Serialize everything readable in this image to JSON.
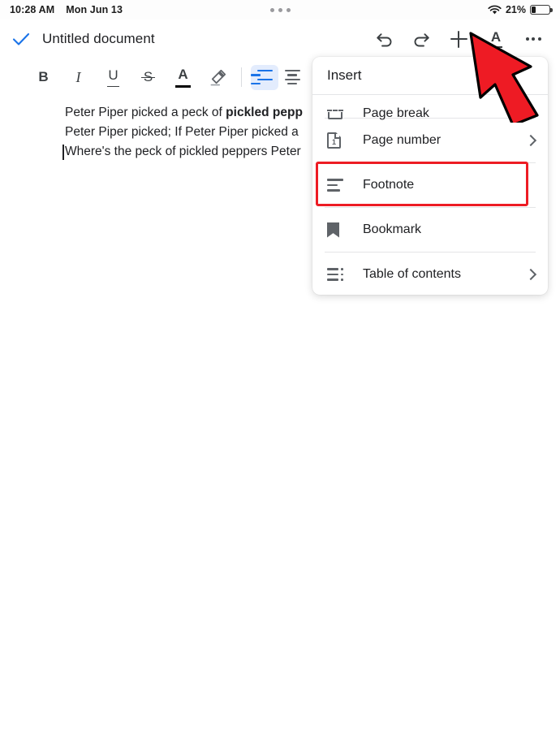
{
  "status_bar": {
    "time": "10:28 AM",
    "date": "Mon Jun 13",
    "battery_percent": "21%",
    "wifi_icon": "wifi-icon",
    "battery_icon": "battery-icon",
    "multitask_handle": "multitask-dots-icon"
  },
  "header": {
    "check_icon": "checkmark-icon",
    "title": "Untitled document",
    "actions": [
      {
        "name": "undo",
        "icon": "undo-icon"
      },
      {
        "name": "redo",
        "icon": "redo-icon"
      },
      {
        "name": "insert",
        "icon": "plus-icon"
      },
      {
        "name": "text-format",
        "icon": "text-format-a-icon",
        "label": "A"
      },
      {
        "name": "more-options",
        "icon": "more-horizontal-icon"
      }
    ]
  },
  "format_toolbar": {
    "bold": "B",
    "italic": "I",
    "underline": "U",
    "strikethrough": "S",
    "text_color": "A",
    "highlight_icon": "highlighter-pen-icon",
    "align_left_icon": "align-left-icon",
    "align_center_icon": "align-center-icon",
    "align_left_active": true,
    "active_color": "#1a73e8",
    "active_bg": "#e3ecfd"
  },
  "document": {
    "lines": [
      {
        "plain": "Peter Piper picked a peck of ",
        "bold": "pickled pepp"
      },
      {
        "plain": "Peter Piper picked; If Peter Piper picked a"
      },
      {
        "plain": "Where's the peck of pickled peppers Peter"
      }
    ]
  },
  "insert_panel": {
    "title": "Insert",
    "items": [
      {
        "label": "Page break",
        "icon": "page-break-icon",
        "chevron": false,
        "clipped": true
      },
      {
        "label": "Page number",
        "icon": "page-number-icon",
        "chevron": true
      },
      {
        "label": "Footnote",
        "icon": "footnote-icon",
        "chevron": false,
        "highlighted": true
      },
      {
        "label": "Bookmark",
        "icon": "bookmark-icon",
        "chevron": false
      },
      {
        "label": "Table of contents",
        "icon": "table-of-contents-icon",
        "chevron": true
      }
    ]
  },
  "annotations": {
    "highlight_color": "#ed1c24",
    "arrow_color": "#ee1b24",
    "arrow_outline": "#000000",
    "arrow_target": "plus-icon",
    "highlight_target": "Footnote"
  }
}
